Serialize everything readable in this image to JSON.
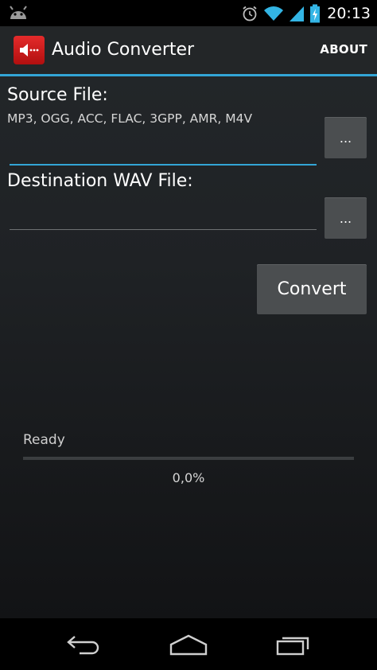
{
  "status_bar": {
    "time": "20:13",
    "icons": [
      "android-icon",
      "alarm-icon",
      "wifi-icon",
      "signal-icon",
      "battery-charging-icon"
    ]
  },
  "action_bar": {
    "title": "Audio Converter",
    "about_label": "ABOUT",
    "icon": "speaker-icon"
  },
  "source": {
    "label": "Source File:",
    "formats": "MP3, OGG, ACC, FLAC, 3GPP, AMR, M4V",
    "value": "",
    "browse_label": "..."
  },
  "destination": {
    "label": "Destination WAV File:",
    "value": "",
    "browse_label": "..."
  },
  "convert_label": "Convert",
  "progress": {
    "status": "Ready",
    "percent_text": "0,0%",
    "fraction": 0.0
  },
  "colors": {
    "accent": "#33a5d6",
    "app_icon": "#d42020",
    "button": "#4b4e50"
  },
  "nav_bar": {
    "buttons": [
      "back-icon",
      "home-icon",
      "recent-apps-icon"
    ]
  }
}
